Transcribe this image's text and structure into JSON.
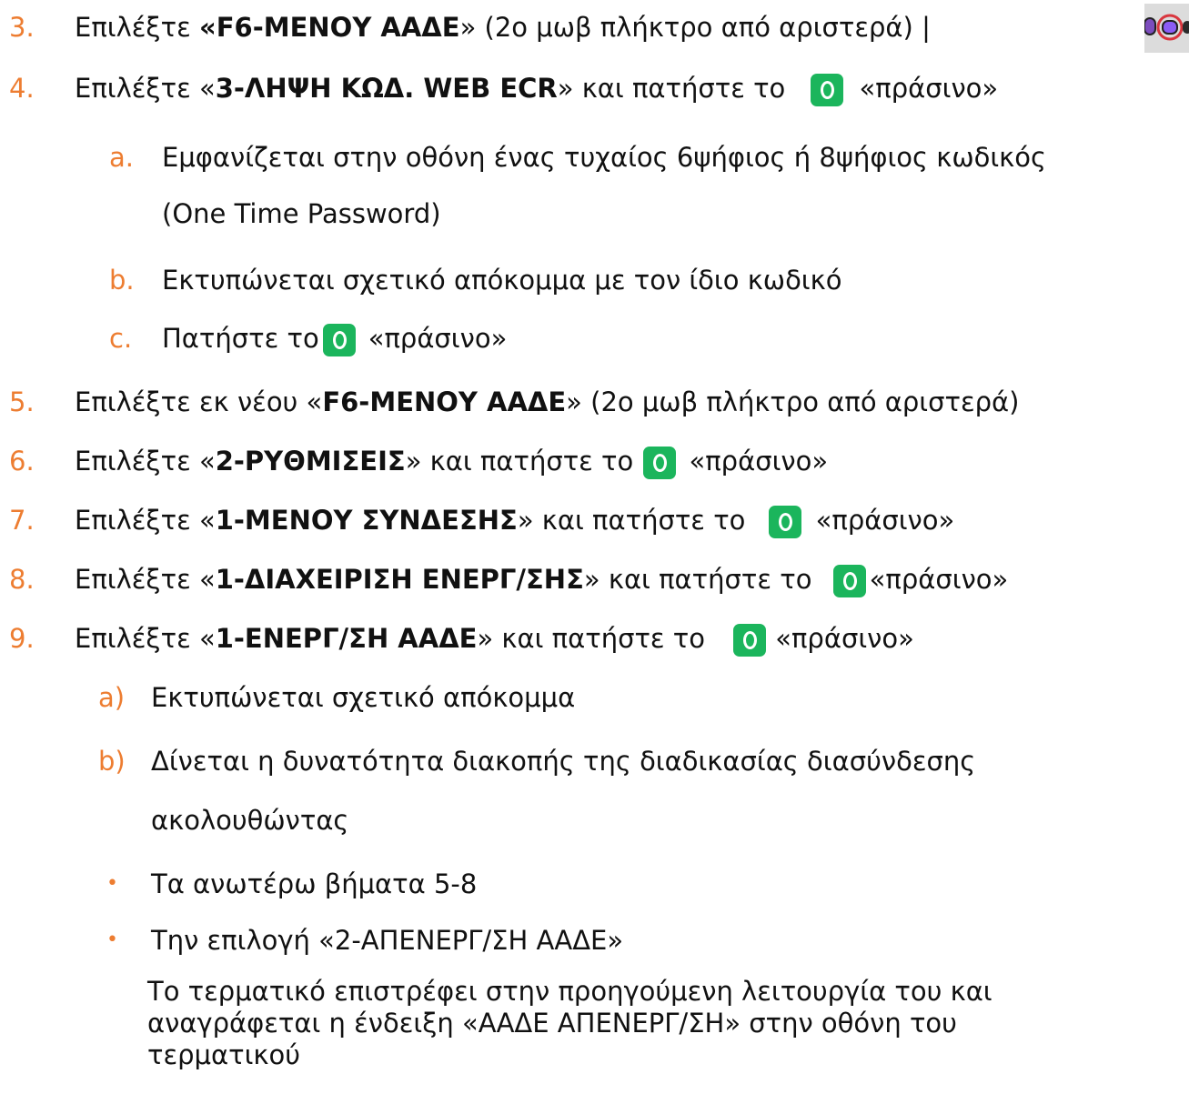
{
  "steps": [
    {
      "num": "3.",
      "pre": "Επιλέξτε ",
      "bold": "«F6-ΜΕΝΟΥ ΑΑΔΕ",
      "post": "» (2ο μωβ πλήκτρο από αριστερά) |"
    },
    {
      "num": "4.",
      "pre": "Επιλέξτε «",
      "bold": "3-ΛΗΨΗ ΚΩΔ. WEB ECR",
      "mid": "» και πατήστε το",
      "after": "«πράσινο»"
    },
    {
      "num": "a.",
      "text1": "Εμφανίζεται στην οθόνη ένας τυχαίος 6ψήφιος ή 8ψήφιος κωδικός",
      "text2": "(One Time Password)"
    },
    {
      "num": "b.",
      "text": "Εκτυπώνεται σχετικό απόκομμα με τον ίδιο κωδικό"
    },
    {
      "num": "c.",
      "pre": "Πατήστε το",
      "after": "«πράσινο»"
    },
    {
      "num": "5.",
      "pre": "Επιλέξτε εκ νέου «",
      "bold": "F6-ΜΕΝΟΥ ΑΑΔΕ",
      "post": "» (2ο μωβ πλήκτρο από αριστερά)"
    },
    {
      "num": "6.",
      "pre": "Επιλέξτε «",
      "bold": "2-ΡΥΘΜΙΣΕΙΣ",
      "mid": "» και πατήστε το",
      "after": "«πράσινο»"
    },
    {
      "num": "7.",
      "pre": "Επιλέξτε «",
      "bold": "1-ΜΕΝΟΥ ΣΥΝΔΕΣΗΣ",
      "mid": "» και πατήστε το",
      "after": "«πράσινο»"
    },
    {
      "num": "8.",
      "pre": "Επιλέξτε «",
      "bold": "1-ΔΙΑΧΕΙΡΙΣΗ ΕΝΕΡΓ/ΣΗΣ",
      "mid": "» και πατήστε το",
      "after": "«πράσινο»"
    },
    {
      "num": "9.",
      "pre": "Επιλέξτε «",
      "bold": "1-ΕΝΕΡΓ/ΣΗ ΑΑΔΕ",
      "mid": "» και πατήστε το",
      "after": "«πράσινο»"
    },
    {
      "num": "a)",
      "text": "Εκτυπώνεται σχετικό απόκομμα"
    },
    {
      "num": "b)",
      "text1": "Δίνεται η δυνατότητα διακοπής της διαδικασίας διασύνδεσης",
      "text2": "ακολουθώντας"
    }
  ],
  "bullets": [
    {
      "symbol": "•",
      "text": "Τα ανωτέρω βήματα 5-8"
    },
    {
      "symbol": "•",
      "text": "Την επιλογή «2-ΑΠΕΝΕΡΓ/ΣΗ ΑΑΔΕ»"
    }
  ],
  "note": {
    "line1": "Το τερματικό επιστρέφει στην προηγούμενη λειτουργία του και",
    "line2": "αναγράφεται η ένδειξη «ΑΑΔΕ ΑΠΕΝΕΡΓ/ΣΗ» στην οθόνη του",
    "line3": "τερματικού"
  },
  "colors": {
    "accent": "#ED7D31",
    "green_button": "#1BB55C",
    "key_purple": "#8B5CF6",
    "highlight_ring": "#D9363E"
  },
  "icons": {
    "green_button": "green-o-button-icon",
    "keys": "purple-keys-image"
  }
}
